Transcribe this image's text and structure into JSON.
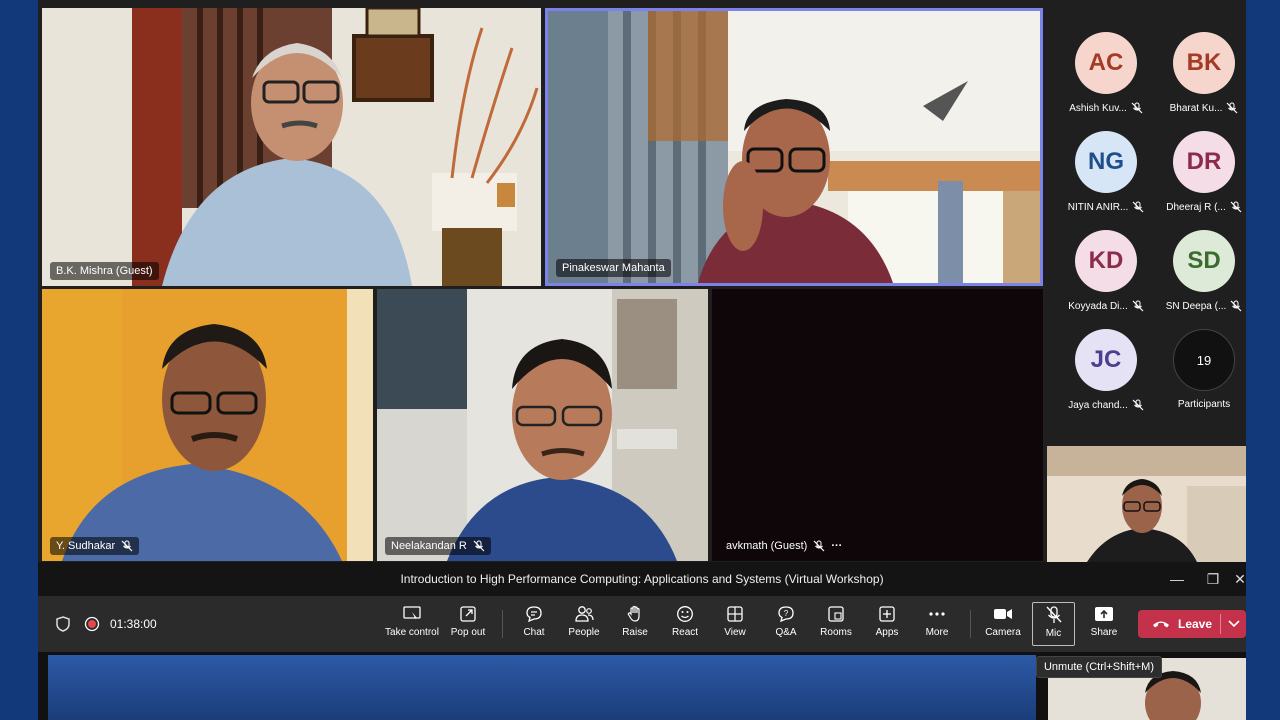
{
  "meeting": {
    "title": "Introduction to High Performance Computing: Applications and Systems (Virtual Workshop)",
    "elapsed": "01:38:00"
  },
  "video_tiles": [
    {
      "name": "B.K. Mishra (Guest)"
    },
    {
      "name": "Pinakeswar Mahanta"
    },
    {
      "name": "Y. Sudhakar"
    },
    {
      "name": "Neelakandan R"
    },
    {
      "name": "avkmath (Guest)",
      "more": "···"
    }
  ],
  "roster": {
    "people": [
      {
        "initials": "AC",
        "name": "Ashish Kuv...",
        "color": "#f6d5cc",
        "text_color": "#a33b25"
      },
      {
        "initials": "BK",
        "name": "Bharat Ku...",
        "color": "#f6d5cc",
        "text_color": "#a33b25"
      },
      {
        "initials": "NG",
        "name": "NITIN ANIR...",
        "color": "#d6e6f7",
        "text_color": "#1e4f8a"
      },
      {
        "initials": "DR",
        "name": "Dheeraj R (...",
        "color": "#f4dde6",
        "text_color": "#8b2c4b"
      },
      {
        "initials": "KD",
        "name": "Koyyada Di...",
        "color": "#f4dde6",
        "text_color": "#8b2c4b"
      },
      {
        "initials": "SD",
        "name": "SN Deepa (...",
        "color": "#dcead7",
        "text_color": "#3c6b2e"
      },
      {
        "initials": "JC",
        "name": "Jaya chand...",
        "color": "#e6e2f5",
        "text_color": "#4b3f8f"
      }
    ],
    "participants_count": "19",
    "participants_label": "Participants"
  },
  "toolbar": {
    "take_control": "Take control",
    "pop_out": "Pop out",
    "chat": "Chat",
    "people": "People",
    "raise": "Raise",
    "react": "React",
    "view": "View",
    "qa": "Q&A",
    "rooms": "Rooms",
    "apps": "Apps",
    "more": "More",
    "camera": "Camera",
    "mic": "Mic",
    "share": "Share",
    "leave": "Leave"
  },
  "tooltip": "Unmute (Ctrl+Shift+M)",
  "colors": {
    "leave": "#c4314b",
    "recording": "#e8474c",
    "active_speaker_border": "#7b83eb",
    "desktop": "#123a7a"
  }
}
